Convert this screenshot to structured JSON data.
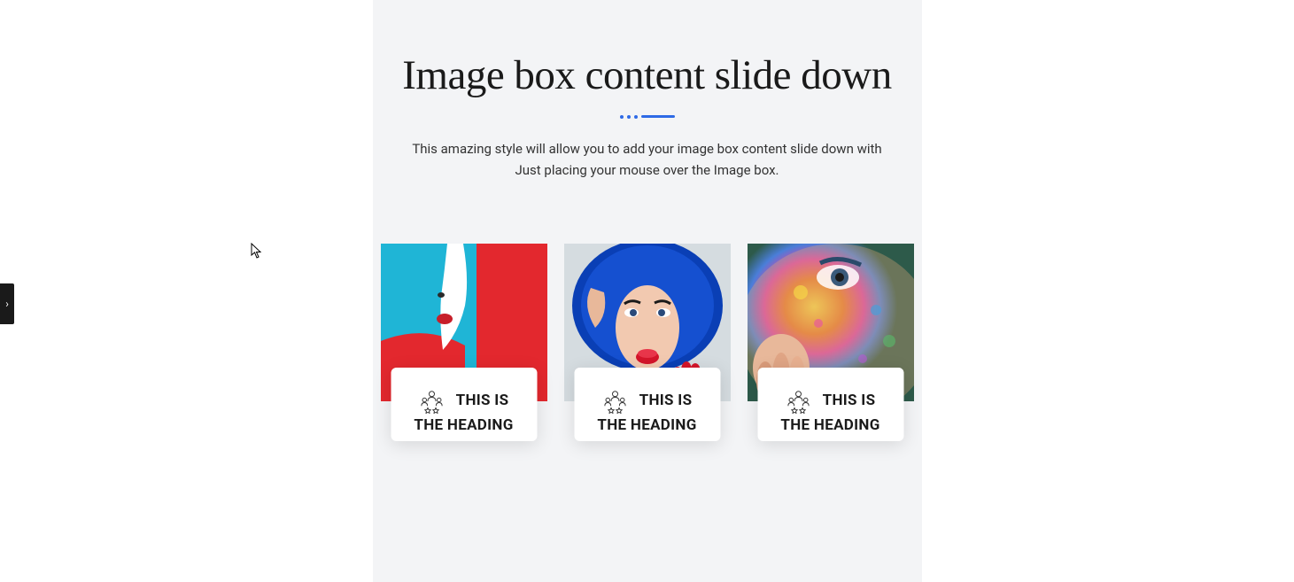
{
  "heading": {
    "title": "Image box content slide down",
    "subtitle": "This amazing style will allow you to add your image box content slide down with Just placing your mouse over the Image box."
  },
  "boxes": [
    {
      "heading": "THIS IS THE HEADING"
    },
    {
      "heading": "THIS IS THE HEADING"
    },
    {
      "heading": "THIS IS THE HEADING"
    }
  ],
  "sideTab": {
    "glyph": "›"
  }
}
